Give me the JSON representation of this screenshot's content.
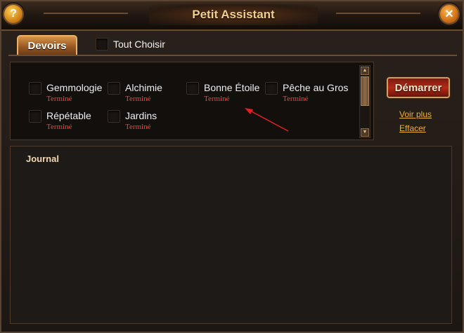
{
  "window": {
    "title": "Petit Assistant",
    "help_icon": "?",
    "close_icon": "✕"
  },
  "tabs": [
    {
      "label": "Devoirs",
      "active": true
    }
  ],
  "select_all": {
    "label": "Tout Choisir",
    "checked": false
  },
  "tasks": [
    {
      "name": "Gemmologie",
      "status": "Terminé",
      "checked": false
    },
    {
      "name": "Alchimie",
      "status": "Terminé",
      "checked": false
    },
    {
      "name": "Bonne Étoile",
      "status": "Terminé",
      "checked": false
    },
    {
      "name": "Pêche au Gros",
      "status": "Terminé",
      "checked": false
    },
    {
      "name": "Répétable",
      "status": "Terminé",
      "checked": false
    },
    {
      "name": "Jardins",
      "status": "Terminé",
      "checked": false
    }
  ],
  "actions": {
    "start_label": "Démarrer",
    "more_label": "Voir plus",
    "clear_label": "Effacer"
  },
  "journal": {
    "title": "Journal"
  },
  "colors": {
    "accent": "#f2cf8c",
    "status": "#e8463a",
    "link": "#f0b030",
    "annotation_arrow": "#e02020"
  }
}
